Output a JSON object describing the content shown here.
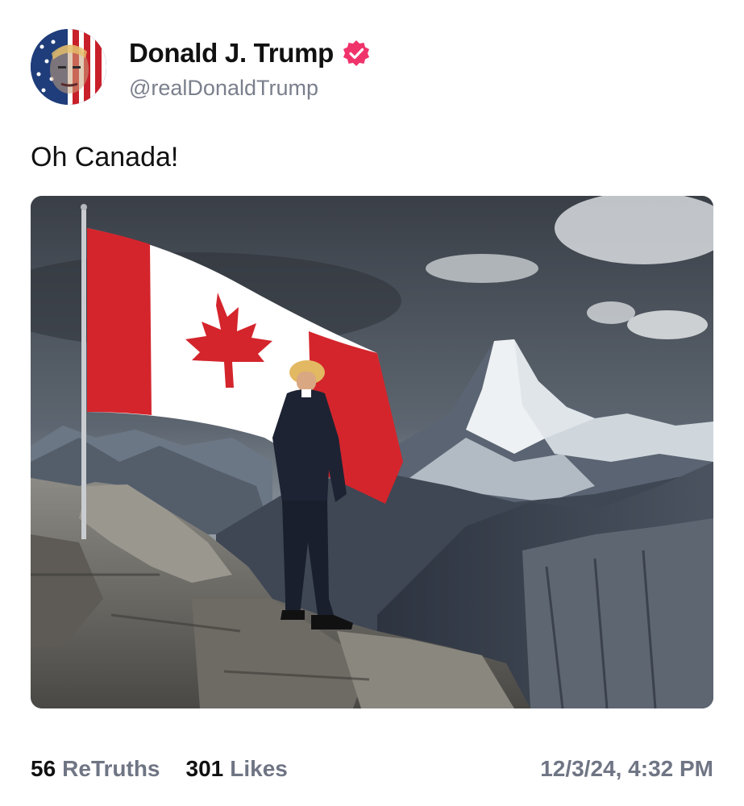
{
  "author": {
    "display_name": "Donald J. Trump",
    "handle": "@realDonaldTrump",
    "verified_icon": "verified-badge-icon",
    "verified_color": "#f0336b"
  },
  "post": {
    "text": "Oh Canada!"
  },
  "stats": {
    "retruths_count": "56",
    "retruths_label": "ReTruths",
    "likes_count": "301",
    "likes_label": "Likes",
    "timestamp": "12/3/24, 4:32 PM"
  },
  "colors": {
    "accent": "#f0336b",
    "muted_text": "#6f7584",
    "flag_red": "#d4252c"
  }
}
